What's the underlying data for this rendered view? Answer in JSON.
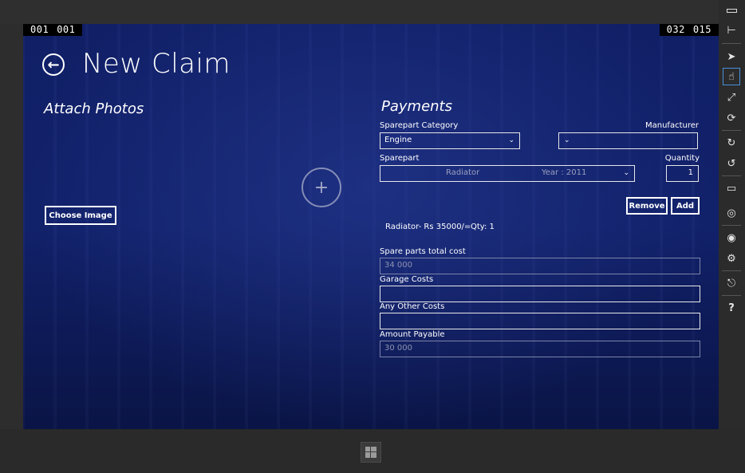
{
  "counters": {
    "left": [
      "001",
      "001"
    ],
    "right": [
      "032",
      "015"
    ]
  },
  "header": {
    "title": "New Claim"
  },
  "attach": {
    "heading": "Attach Photos",
    "choose_label": "Choose Image",
    "add_glyph": "+"
  },
  "payments": {
    "heading": "Payments",
    "category_label": "Sparepart Category",
    "category_value": "Engine",
    "manufacturer_label": "Manufacturer",
    "manufacturer_value": "",
    "sparepart_label": "Sparepart",
    "sparepart_name": "Radiator",
    "sparepart_year": "Year :  2011",
    "quantity_label": "Quantity",
    "quantity_value": "1",
    "remove_label": "Remove",
    "add_label": "Add",
    "line_item": "Radiator- Rs 35000/=",
    "line_qty": "Qty: 1",
    "total_label": "Spare parts total cost",
    "total_value": "34 000",
    "garage_label": "Garage Costs",
    "garage_value": "",
    "other_label": "Any Other Costs",
    "other_value": "",
    "payable_label": "Amount Payable",
    "payable_value": "30 000"
  },
  "icons": {
    "back": "back-arrow-icon",
    "toolbar": [
      "minimize-icon",
      "pin-icon",
      "pointer-icon",
      "touch-icon",
      "pinch-icon",
      "rotate-touch-icon",
      "rotate-cw-icon",
      "rotate-ccw-icon",
      "monitor-icon",
      "globe-icon",
      "camera-icon",
      "gear-icon",
      "network-icon",
      "help-icon"
    ]
  },
  "colors": {
    "background": "#12226e",
    "text": "#ffffff",
    "field_border": "#e8e8e8",
    "disabled_text": "#8d93ad",
    "active_tool": "#4a90d9"
  }
}
